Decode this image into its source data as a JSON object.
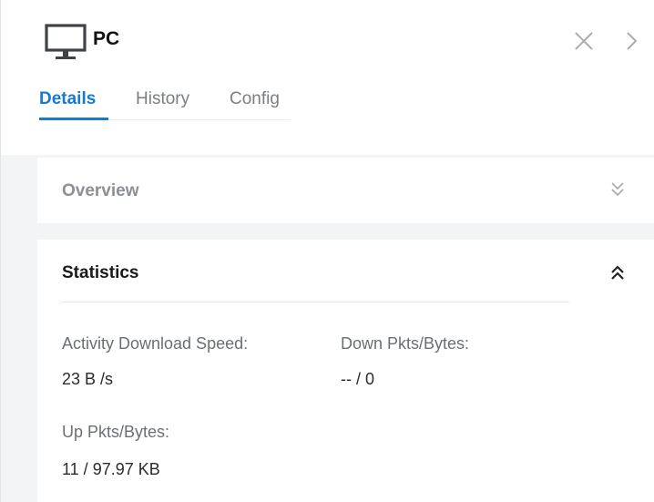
{
  "device": {
    "name": "PC",
    "icon": "monitor-icon"
  },
  "header": {
    "close_icon": "close-icon",
    "next_icon": "chevron-right-icon"
  },
  "tabs": [
    {
      "label": "Details",
      "active": true
    },
    {
      "label": "History",
      "active": false
    },
    {
      "label": "Config",
      "active": false
    }
  ],
  "overview": {
    "title": "Overview",
    "state": "collapsed",
    "toggle_icon": "double-chevron-down-icon"
  },
  "statistics": {
    "title": "Statistics",
    "state": "expanded",
    "toggle_icon": "double-chevron-up-icon",
    "items": [
      {
        "label": "Activity Download Speed:",
        "value": "23 B /s"
      },
      {
        "label": "Down Pkts/Bytes:",
        "value": "-- / 0"
      },
      {
        "label": "Up Pkts/Bytes:",
        "value": "11 / 97.97 KB"
      }
    ]
  },
  "colors": {
    "accent": "#1679d2",
    "panel_bg": "#f3f4f6",
    "card_bg": "#ffffff"
  }
}
